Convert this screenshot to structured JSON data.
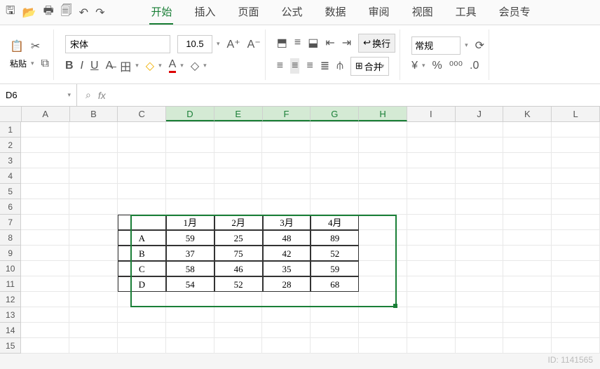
{
  "qat": {
    "save": "🖫",
    "open": "📂",
    "print": "🖶",
    "preview": "🗐",
    "undo": "↶",
    "redo": "↷"
  },
  "tabs": [
    "开始",
    "插入",
    "页面",
    "公式",
    "数据",
    "审阅",
    "视图",
    "工具",
    "会员专"
  ],
  "activeTab": 0,
  "ribbon": {
    "paste_label": "粘贴",
    "font_name": "宋体",
    "font_size": "10.5",
    "wrap_label": "换行",
    "merge_label": "合并",
    "numfmt": "常规"
  },
  "namebox": "D6",
  "formula": "",
  "columns": [
    "A",
    "B",
    "C",
    "D",
    "E",
    "F",
    "G",
    "H",
    "I",
    "J",
    "K",
    "L"
  ],
  "selectedCols": [
    "D",
    "E",
    "F",
    "G",
    "H"
  ],
  "table": {
    "headers": [
      "",
      "1月",
      "2月",
      "3月",
      "4月"
    ],
    "rows": [
      [
        "A",
        "59",
        "25",
        "48",
        "89"
      ],
      [
        "B",
        "37",
        "75",
        "42",
        "52"
      ],
      [
        "C",
        "58",
        "46",
        "35",
        "59"
      ],
      [
        "D",
        "54",
        "52",
        "28",
        "68"
      ]
    ]
  },
  "chart_data": {
    "type": "table",
    "title": "",
    "categories": [
      "1月",
      "2月",
      "3月",
      "4月"
    ],
    "series": [
      {
        "name": "A",
        "values": [
          59,
          25,
          48,
          89
        ]
      },
      {
        "name": "B",
        "values": [
          37,
          75,
          42,
          52
        ]
      },
      {
        "name": "C",
        "values": [
          58,
          46,
          35,
          59
        ]
      },
      {
        "name": "D",
        "values": [
          54,
          52,
          28,
          68
        ]
      }
    ]
  },
  "watermark": "ID: 1141565"
}
